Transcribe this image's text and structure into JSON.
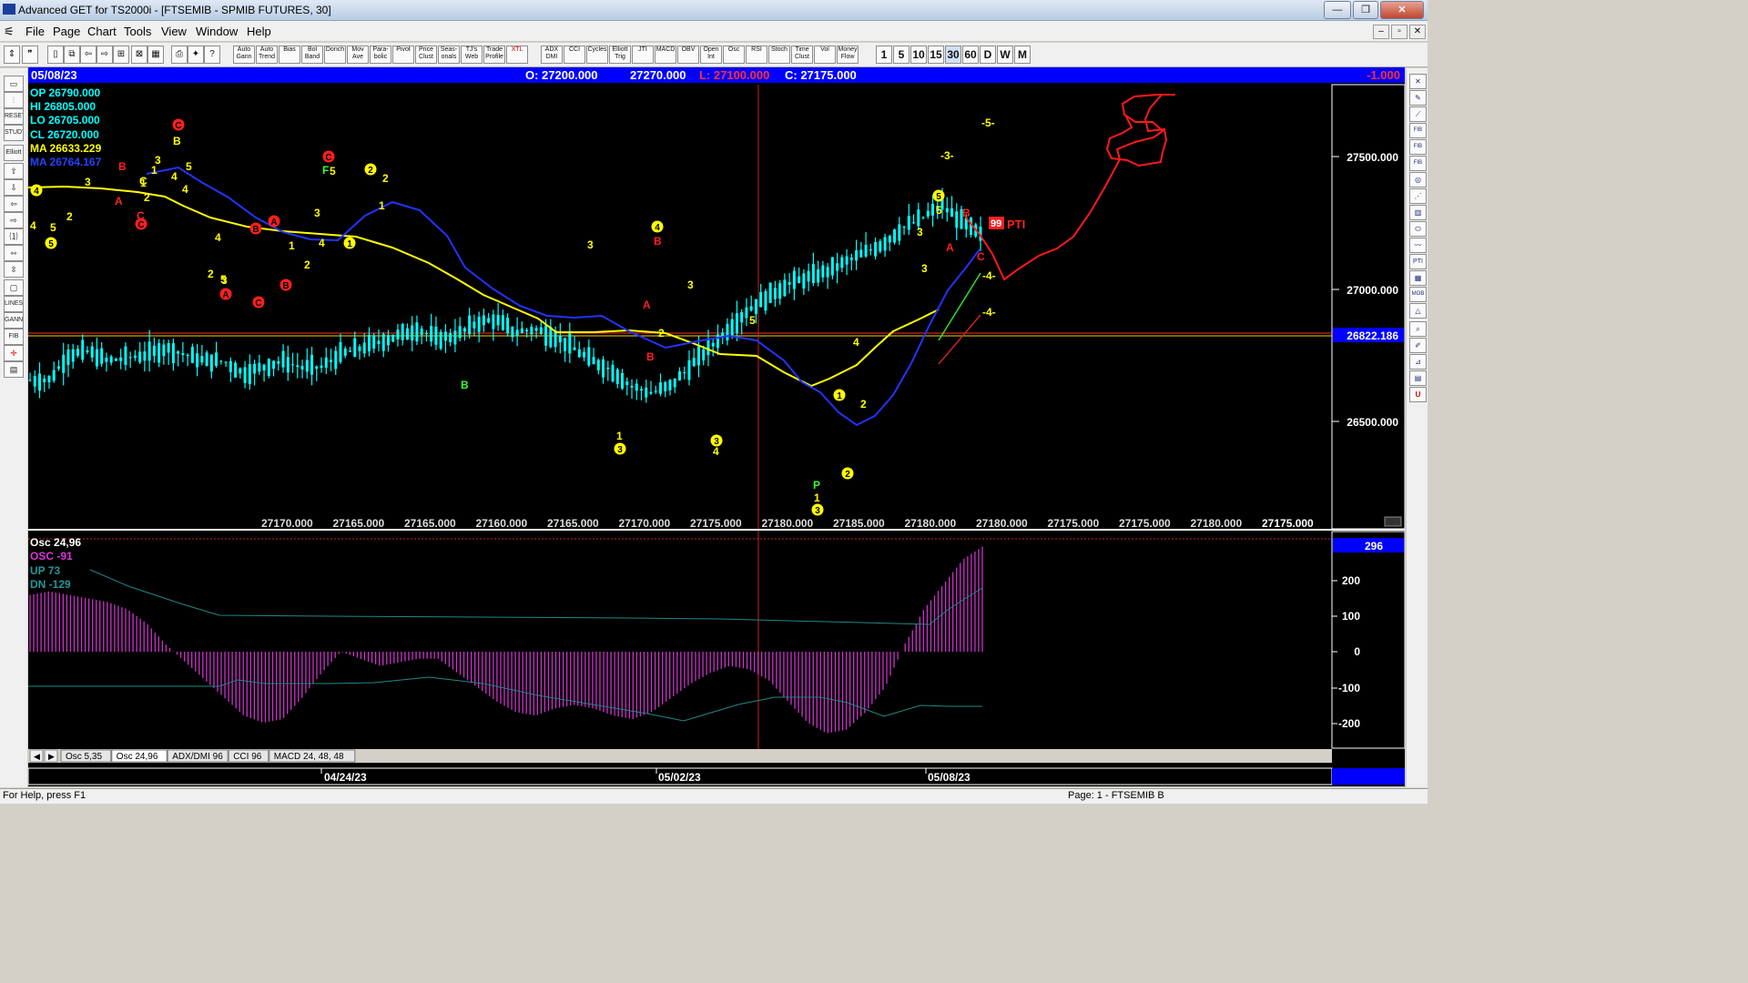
{
  "window": {
    "title": "Advanced GET for TS2000i - [FTSEMIB - SPMIB FUTURES, 30]",
    "buttons": [
      "—",
      "❐",
      "✕"
    ],
    "mdi_buttons": [
      "–",
      "▫",
      "✕"
    ]
  },
  "menu": [
    "File",
    "Page",
    "Chart",
    "Tools",
    "View",
    "Window",
    "Help"
  ],
  "toolbar": {
    "study_buttons": [
      "Auto Gann",
      "Auto Trend",
      "Bias",
      "Bol Band",
      "Donch",
      "Mov Ave",
      "Para-bolic",
      "Pivot",
      "Price Clust",
      "Seas-onals",
      "TJ's Web",
      "Trade Profile",
      "XTL",
      "ADX DMI",
      "CCI",
      "Cycles",
      "Elliott Trig",
      "JTI",
      "MACD",
      "OBV",
      "Open Int",
      "Osc",
      "RSI",
      "Stoch",
      "Time Clust",
      "Vol",
      "Money Flow"
    ],
    "periods": [
      "1",
      "5",
      "10",
      "15",
      "30",
      "60",
      "D",
      "W",
      "M"
    ],
    "active_period": "30"
  },
  "left_toolbar": [
    "RESET",
    "STUDY",
    "Elliott",
    "LINES",
    "GANN",
    "FIB"
  ],
  "right_toolbar": [
    "FIB RET",
    "FIB EXT",
    "FIB TIME",
    "PTI",
    "MOB"
  ],
  "chart_header": {
    "date": "05/08/23",
    "open": "O: 27200.000",
    "high": "27270.000",
    "low": "L:  27100.000",
    "close": "C:  27175.000",
    "change": "-1.000"
  },
  "price_info": {
    "op": "OP  26790.000",
    "hi": "HI    26805.000",
    "lo": "LO   26705.000",
    "cl": "CL   26720.000",
    "ma_yellow": "MA  26633.229",
    "ma_blue": "MA  26764.167"
  },
  "price_axis": {
    "labels": [
      "27500.000",
      "27000.000",
      "26500.000"
    ],
    "current_price": "26822.186"
  },
  "bottom_price_row": [
    "27170.000",
    "27165.000",
    "27165.000",
    "27160.000",
    "27165.000",
    "27170.000",
    "27175.000",
    "27180.000",
    "27185.000",
    "27180.000",
    "27180.000",
    "27175.000",
    "27175.000",
    "27180.000",
    "27175.000"
  ],
  "wave_labels": {
    "elliott": [
      "4",
      "5",
      "2",
      "3",
      "B",
      "C",
      "1",
      "2",
      "4",
      "5",
      "3",
      "4",
      "1",
      "2",
      "3",
      "4",
      "5",
      "2",
      "1",
      "3",
      "4",
      "5",
      "1",
      "2",
      "3",
      "1",
      "2",
      "3",
      "4",
      "5",
      "4",
      "2",
      "1",
      "3",
      "5",
      "3",
      "4",
      "3",
      "5",
      "4",
      "1",
      "2",
      "1",
      "2",
      "3",
      "4",
      "5",
      "3"
    ],
    "abc": [
      "B",
      "A",
      "C",
      "C",
      "B",
      "B",
      "A",
      "A",
      "C",
      "B",
      "C",
      "A",
      "B",
      "B",
      "A",
      "C"
    ],
    "circled_red": [
      "C",
      "C",
      "B",
      "A",
      "A",
      "C",
      "B",
      "C"
    ],
    "circled_yellow": [
      "4",
      "5",
      "1",
      "2",
      "4",
      "3",
      "3",
      "1",
      "2",
      "5",
      "3"
    ],
    "green": [
      "B",
      "F",
      "P"
    ],
    "projections": [
      "-5-",
      "-3-",
      "-4-",
      "-4-"
    ],
    "pti": "PTI",
    "pti_value": "99"
  },
  "oscillator": {
    "title": "Osc 24,96",
    "osc": "OSC -91",
    "up": "UP   73",
    "dn": "DN   -129",
    "current_value": "296",
    "axis": [
      "200",
      "100",
      "0",
      "-100",
      "-200"
    ]
  },
  "tabs": [
    "Osc 5,35",
    "Osc 24,96",
    "ADX/DMI 96",
    "CCI 96",
    "MACD 24, 48, 48"
  ],
  "active_tab": "Osc 24,96",
  "date_axis": [
    "04/24/23",
    "05/02/23",
    "05/08/23"
  ],
  "status": {
    "left": "For Help, press F1",
    "right": "Page: 1 - FTSEMIB B"
  },
  "colors": {
    "background": "#000000",
    "candles": "#00ffff",
    "ma_yellow": "#ffff00",
    "ma_blue": "#2222ff",
    "oscillator": "#cc33cc",
    "projection": "#ff2222",
    "header_bar": "#0000ff",
    "wave_yellow": "#ffff00",
    "wave_red": "#ff2020",
    "wave_green": "#33ff33"
  },
  "series": {
    "price_path": [
      26720,
      26720,
      26800,
      26810,
      26780,
      26790,
      26800,
      26820,
      26800,
      26780,
      26780,
      26740,
      26760,
      26780,
      26760,
      26760,
      26800,
      26820,
      26840,
      26860,
      26880,
      26850,
      26860,
      26900,
      26910,
      26870,
      26880,
      26860,
      26820,
      26780,
      26750,
      26700,
      26680,
      26700,
      26760,
      26820,
      26880,
      26940,
      26980,
      27020,
      27040,
      27060,
      27090,
      27120,
      27150,
      27200,
      27230,
      27270,
      27220,
      27175
    ],
    "price_range": [
      26300,
      27650
    ],
    "oscillator_path": [
      160,
      170,
      160,
      150,
      140,
      120,
      80,
      20,
      -30,
      -80,
      -130,
      -180,
      -200,
      -190,
      -130,
      -60,
      0,
      -20,
      -40,
      -30,
      -20,
      -20,
      -60,
      -100,
      -140,
      -170,
      -180,
      -160,
      -150,
      -160,
      -180,
      -190,
      -170,
      -130,
      -90,
      -60,
      -40,
      -50,
      -80,
      -140,
      -200,
      -230,
      -220,
      -170,
      -100,
      20,
      120,
      190,
      260,
      296
    ],
    "osc_range": [
      -260,
      320
    ]
  }
}
